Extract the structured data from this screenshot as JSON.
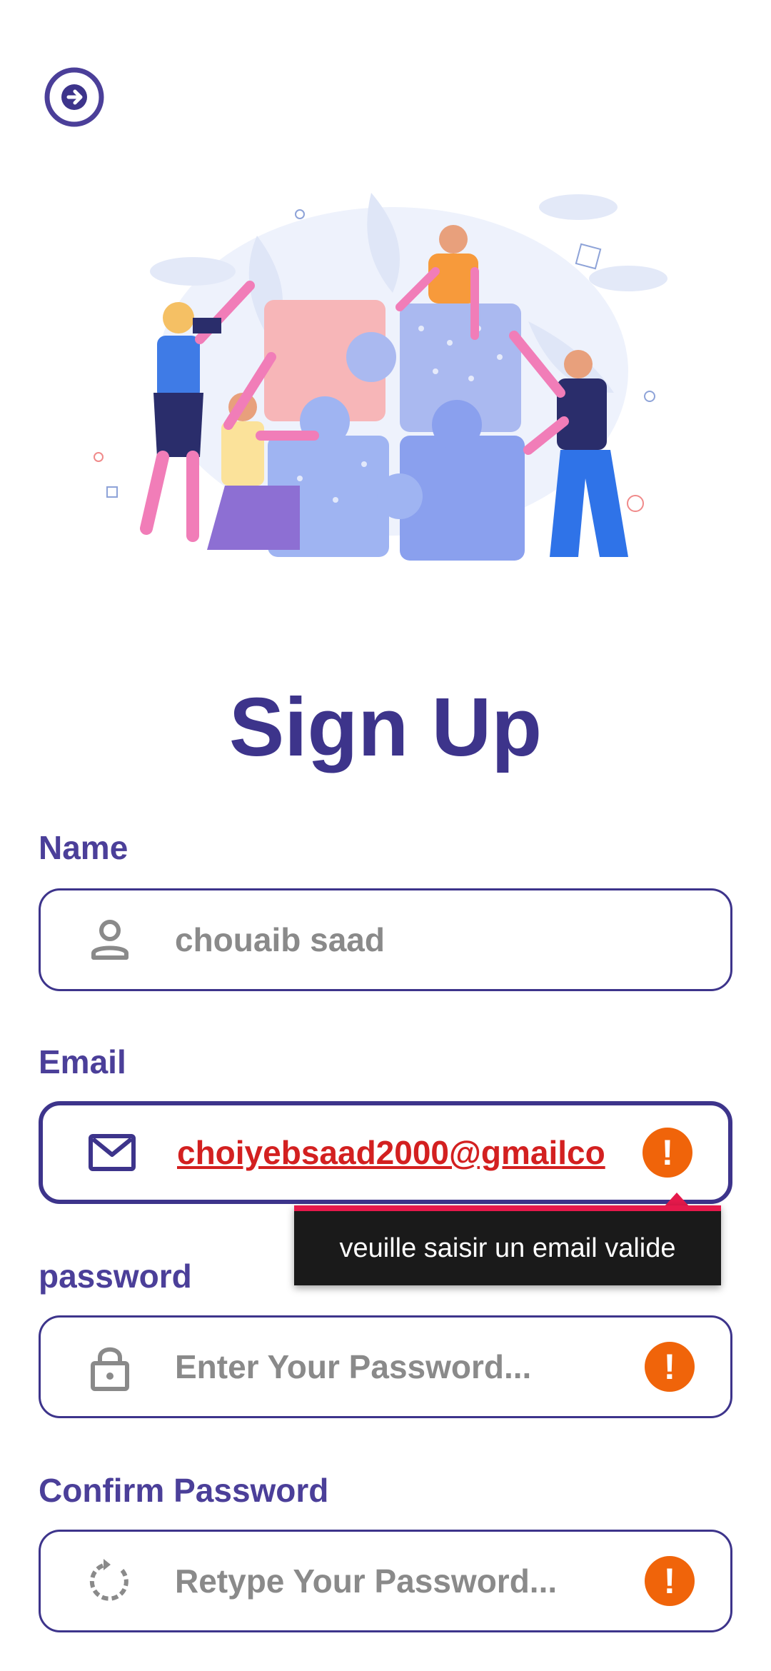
{
  "page": {
    "title": "Sign Up"
  },
  "colors": {
    "primary": "#3d348b",
    "label": "#4b3f99",
    "error_badge": "#f0640a",
    "error_text": "#d32020",
    "tooltip_bg": "#1a1a1a",
    "tooltip_accent": "#e5194b"
  },
  "icons": {
    "back": "arrow-right-circle-icon",
    "name": "person-icon",
    "email": "mail-icon",
    "password": "lock-icon",
    "confirm": "refresh-icon",
    "error": "error-exclamation-icon"
  },
  "form": {
    "name": {
      "label": "Name",
      "value": "chouaib saad"
    },
    "email": {
      "label": "Email",
      "value": "choiyebsaad2000@gmailco",
      "error_tooltip": "veuille saisir un email valide"
    },
    "password": {
      "label": "password",
      "placeholder": "Enter Your Password..."
    },
    "confirm_password": {
      "label": "Confirm Password",
      "placeholder": "Retype Your Password..."
    },
    "error_symbol": "!"
  }
}
